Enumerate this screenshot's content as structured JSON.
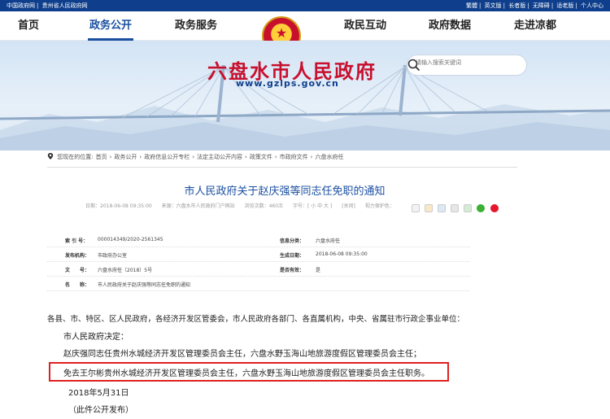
{
  "topbar": {
    "left_links": [
      "中国政府网",
      "贵州省人民政府网"
    ],
    "right_links": [
      "繁體",
      "英文版",
      "长者版",
      "无障碍",
      "适老版",
      "个人中心"
    ]
  },
  "nav": {
    "items": [
      {
        "label": "首页",
        "active": false
      },
      {
        "label": "政务公开",
        "active": true
      },
      {
        "label": "政务服务",
        "active": false
      },
      {
        "label": "政民互动",
        "active": false
      },
      {
        "label": "政府数据",
        "active": false
      },
      {
        "label": "走进凉都",
        "active": false
      }
    ]
  },
  "banner": {
    "title": "六盘水市人民政府",
    "url": "www.gzlps.gov.cn",
    "search_placeholder": "请输入搜索关键词"
  },
  "breadcrumb": {
    "prefix": "您现在的位置:",
    "items": [
      "首页",
      "政务公开",
      "政府信息公开专栏",
      "法定主动公开内容",
      "政策文件",
      "市政府文件",
      "六盘水府任"
    ],
    "separator": "›"
  },
  "article": {
    "title": "市人民政府关于赵庆强等同志任免职的通知",
    "meta": {
      "date": "日期：2018-06-08 09:35:00",
      "source": "来源：六盘水市人民政府门户网站",
      "views": "浏览次数：460次",
      "font_size": "字号：[ 小 中 大 ]",
      "close": "[关闭]",
      "share_label": "视力保护色："
    }
  },
  "info_table": {
    "rows": [
      {
        "l1": "索 引 号：",
        "v1": "000014349/2020-2561345",
        "l2": "信息分类：",
        "v2": "六盘水府任"
      },
      {
        "l1": "发布机构：",
        "v1": "市政府办公室",
        "l2": "生成日期：",
        "v2": "2018-06-08 09:35:00"
      },
      {
        "l1": "文　　号：",
        "v1": "六盘水府任〔2018〕5号",
        "l2": "是否有效：",
        "v2": "是"
      },
      {
        "l1": "名　　称：",
        "v1": "市人民政府关于赵庆强等同志任免职的通知",
        "l2": "",
        "v2": ""
      }
    ]
  },
  "body": {
    "p1": "各县、市、特区、区人民政府，各经济开发区管委会，市人民政府各部门、各直属机构，中央、省属驻市行政企事业单位：",
    "p2": "市人民政府决定：",
    "p3": "赵庆强同志任贵州水城经济开发区管理委员会主任，六盘水野玉海山地旅游度假区管理委员会主任；",
    "p4": "免去王尔彬贵州水城经济开发区管理委员会主任，六盘水野玉海山地旅游度假区管理委员会主任职务。",
    "p5": "2018年5月31日",
    "p6": "（此件公开发布）"
  },
  "colors": {
    "topbar": "#0f3f8c",
    "accent": "#1a4fa0",
    "title_red": "#c8102e",
    "highlight": "#e02020"
  }
}
